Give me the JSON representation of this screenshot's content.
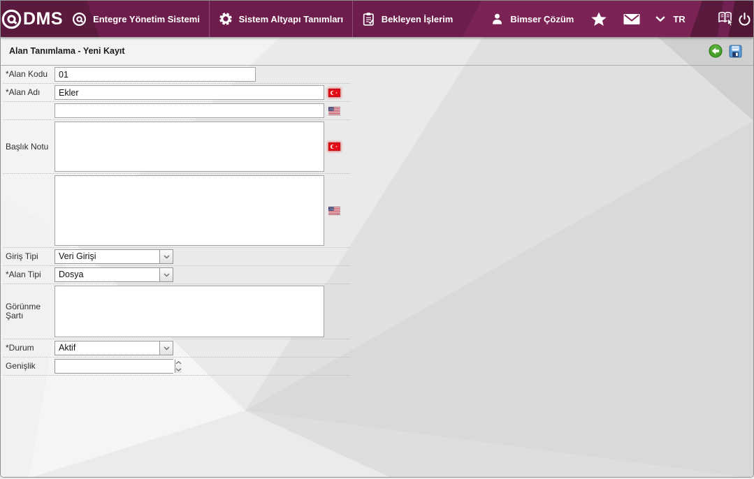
{
  "topbar": {
    "logo_text": "DMS",
    "nav": [
      {
        "label": "Entegre Yönetim Sistemi"
      },
      {
        "label": "Sistem Altyapı Tanımları"
      },
      {
        "label": "Bekleyen İşlerim"
      },
      {
        "label": "Bimser Çözüm"
      }
    ],
    "language": "TR"
  },
  "page": {
    "title": "Alan Tanımlama - Yeni Kayıt"
  },
  "form": {
    "fields": [
      {
        "label": "*Alan Kodu",
        "value": "01"
      },
      {
        "label": "*Alan Adı",
        "value": "Ekler"
      },
      {
        "label": "",
        "value": ""
      },
      {
        "label": "Başlık Notu",
        "value": ""
      },
      {
        "label": "",
        "value": ""
      },
      {
        "label": "Giriş Tipi",
        "value": "Veri Girişi"
      },
      {
        "label": "*Alan Tipi",
        "value": "Dosya"
      },
      {
        "label": "Görünme Şartı",
        "value": ""
      },
      {
        "label": "*Durum",
        "value": "Aktif"
      },
      {
        "label": "Genişlik",
        "value": ""
      }
    ]
  },
  "colors": {
    "topbar_dark": "#5a1a3e",
    "topbar_main": "#6d1d4b",
    "topbar_light": "#7b2355",
    "back_green": "#4aa02c",
    "save_blue": "#5b9bd5",
    "flag_red": "#e30a17"
  }
}
